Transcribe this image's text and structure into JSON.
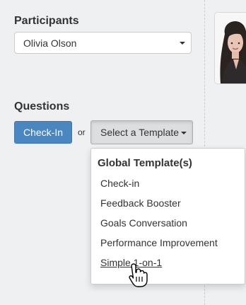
{
  "participants": {
    "label": "Participants",
    "selected": "Olivia Olson"
  },
  "questions": {
    "label": "Questions",
    "checkin_button": "Check-In",
    "or_text": "or",
    "template_button": "Select a Template"
  },
  "template_menu": {
    "header": "Global Template(s)",
    "items": [
      "Check-in",
      "Feedback Booster",
      "Goals Conversation",
      "Performance Improvement",
      "Simple 1-on-1"
    ]
  }
}
